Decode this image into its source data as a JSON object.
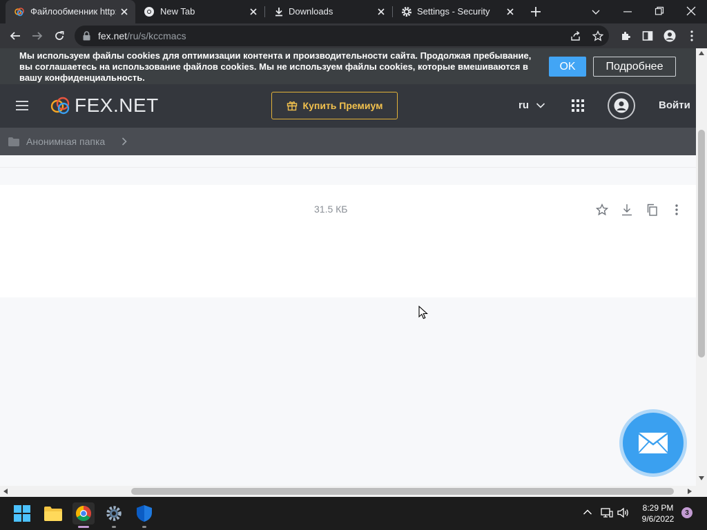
{
  "browser": {
    "tabs": [
      {
        "title": "Файлообменник http:/",
        "icon": "fex-favicon",
        "active": true
      },
      {
        "title": "New Tab",
        "icon": "chrome-icon",
        "active": false
      },
      {
        "title": "Downloads",
        "icon": "download-icon",
        "active": false
      },
      {
        "title": "Settings - Security",
        "icon": "gear-icon",
        "active": false
      }
    ],
    "new_tab_icon": "plus-icon",
    "url_host": "fex.net",
    "url_path": "/ru/s/kccmacs"
  },
  "cookie_banner": {
    "text": "Мы используем файлы cookies для оптимизации контента и производительности сайта. Продолжая пребывание, вы соглашаетесь на использование файлов cookies. Мы не используем файлы cookies, которые вмешиваются в вашу конфиденциальность.",
    "ok_label": "OK",
    "more_label": "Подробнее"
  },
  "header": {
    "logo_text": "FEX.NET",
    "premium_label": "Купить Премиум",
    "language": "ru",
    "login_label": "Войти"
  },
  "breadcrumb": {
    "folder_label": "Анонимная папка"
  },
  "file": {
    "size": "31.5 КБ",
    "actions": [
      "star-icon",
      "download-icon",
      "copy-icon",
      "more-vert-icon"
    ]
  },
  "taskbar": {
    "apps": [
      "windows-start-icon",
      "file-explorer-icon",
      "chrome-icon",
      "settings-icon",
      "defender-icon"
    ],
    "time": "8:29 PM",
    "date": "9/6/2022",
    "notification_count": "3"
  },
  "colors": {
    "accent_blue": "#42a5f5",
    "premium_gold": "#e3b33a",
    "header_bg": "#34373d"
  }
}
